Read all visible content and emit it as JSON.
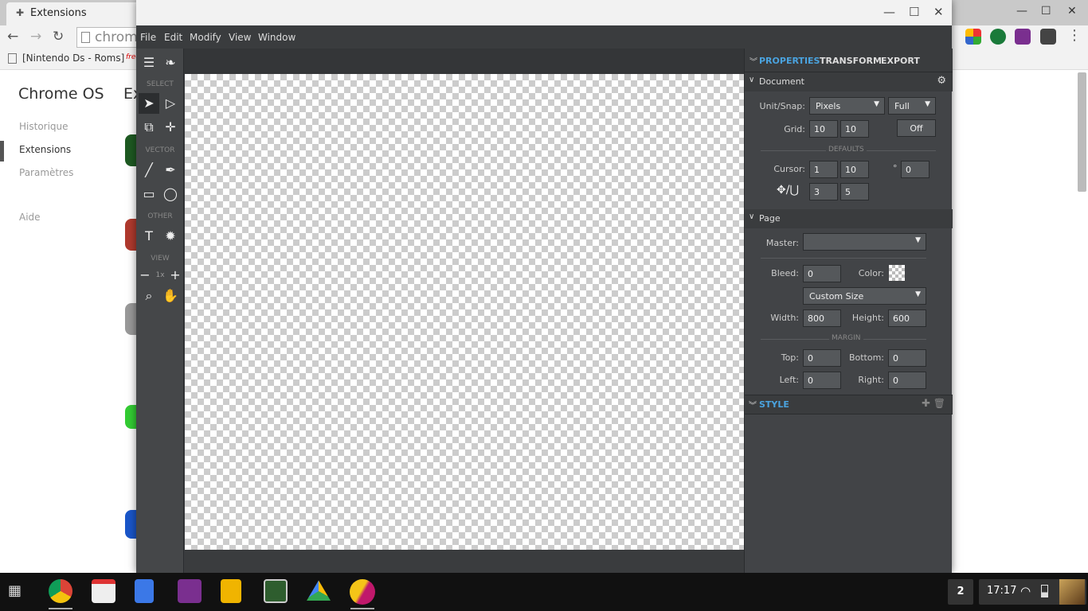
{
  "chrome": {
    "tab_title": "Extensions",
    "omnibox_text": "chrom",
    "bookmark_1": "[Nintendo Ds - Roms]",
    "bookmark_2": "free",
    "sidebar_title": "Chrome OS",
    "page_title_partial": "Ex",
    "sidebar_items": [
      "Historique",
      "Extensions",
      "Paramètres",
      "Aide"
    ]
  },
  "app": {
    "menu": [
      "File",
      "Edit",
      "Modify",
      "View",
      "Window"
    ],
    "toolbox": {
      "section_select": "SELECT",
      "section_vector": "VECTOR",
      "section_other": "OTHER",
      "section_view": "VIEW",
      "zoom_label": "1x"
    },
    "panel": {
      "tabs": [
        "PROPERTIES",
        "TRANSFORM",
        "EXPORT"
      ],
      "document": {
        "header": "Document",
        "unit_snap_label": "Unit/Snap:",
        "unit_value": "Pixels",
        "snap_value": "Full",
        "grid_label": "Grid:",
        "grid_x": "10",
        "grid_y": "10",
        "grid_toggle": "Off",
        "defaults_label": "DEFAULTS",
        "cursor_label": "Cursor:",
        "cursor_1": "1",
        "cursor_2": "10",
        "degree_symbol": "°",
        "angle": "0",
        "nudge_1": "3",
        "nudge_2": "5"
      },
      "page": {
        "header": "Page",
        "master_label": "Master:",
        "master_value": "",
        "bleed_label": "Bleed:",
        "bleed_value": "0",
        "color_label": "Color:",
        "size_preset": "Custom Size",
        "width_label": "Width:",
        "width_value": "800",
        "height_label": "Height:",
        "height_value": "600",
        "margin_label": "MARGIN",
        "top_label": "Top:",
        "top_value": "0",
        "bottom_label": "Bottom:",
        "bottom_value": "0",
        "left_label": "Left:",
        "left_value": "0",
        "right_label": "Right:",
        "right_value": "0"
      },
      "style_header": "STYLE"
    }
  },
  "shelf": {
    "notification_count": "2",
    "clock": "17:17"
  },
  "colors": {
    "accent": "#4aa3df",
    "app_bg": "#3b3d40",
    "panel_bg": "#424447"
  }
}
